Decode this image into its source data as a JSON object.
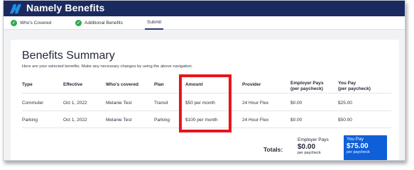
{
  "app": {
    "title": "Namely Benefits"
  },
  "tabs": [
    {
      "label": "Who's Covered",
      "completed": true
    },
    {
      "label": "Additional Benefits",
      "completed": true
    },
    {
      "label": "Submit",
      "completed": false,
      "active": true
    }
  ],
  "summary": {
    "title": "Benefits Summary",
    "instructions": "Here are your selected benefits. Make any necessary changes by using the above navigation."
  },
  "table": {
    "headers": {
      "type": "Type",
      "effective": "Effective",
      "covered": "Who's covered",
      "plan": "Plan",
      "amount": "Amount",
      "provider": "Provider",
      "employer_line1": "Employer Pays",
      "employer_line2": "(per paycheck)",
      "you_line1": "You Pay",
      "you_line2": "(per paycheck)"
    },
    "rows": [
      {
        "type": "Commuter",
        "effective": "Oct 1, 2022",
        "covered": "Melanie Test",
        "plan": "Transit",
        "amount": "$50 per month",
        "provider": "24 Hour Flex",
        "employer": "$0.00",
        "you": "$25.00"
      },
      {
        "type": "Parking",
        "effective": "Oct 1, 2022",
        "covered": "Melanie Test",
        "plan": "Parking",
        "amount": "$100 per month",
        "provider": "24 Hour Flex",
        "employer": "$0.00",
        "you": "$50.00"
      }
    ]
  },
  "totals": {
    "label": "Totals:",
    "employer": {
      "label": "Employer Pays",
      "amount": "$0.00",
      "sub": "per paycheck"
    },
    "you": {
      "label": "You Pay",
      "amount": "$75.00",
      "sub": "per paycheck"
    }
  },
  "colors": {
    "header_bg": "#1b2a5e",
    "check_green": "#2ea84a",
    "highlight_red": "#e8141c",
    "you_pay_blue": "#0f5fd8"
  },
  "icons": {
    "logo": "namely-logo-icon",
    "tab_check": "check-circle-icon"
  }
}
